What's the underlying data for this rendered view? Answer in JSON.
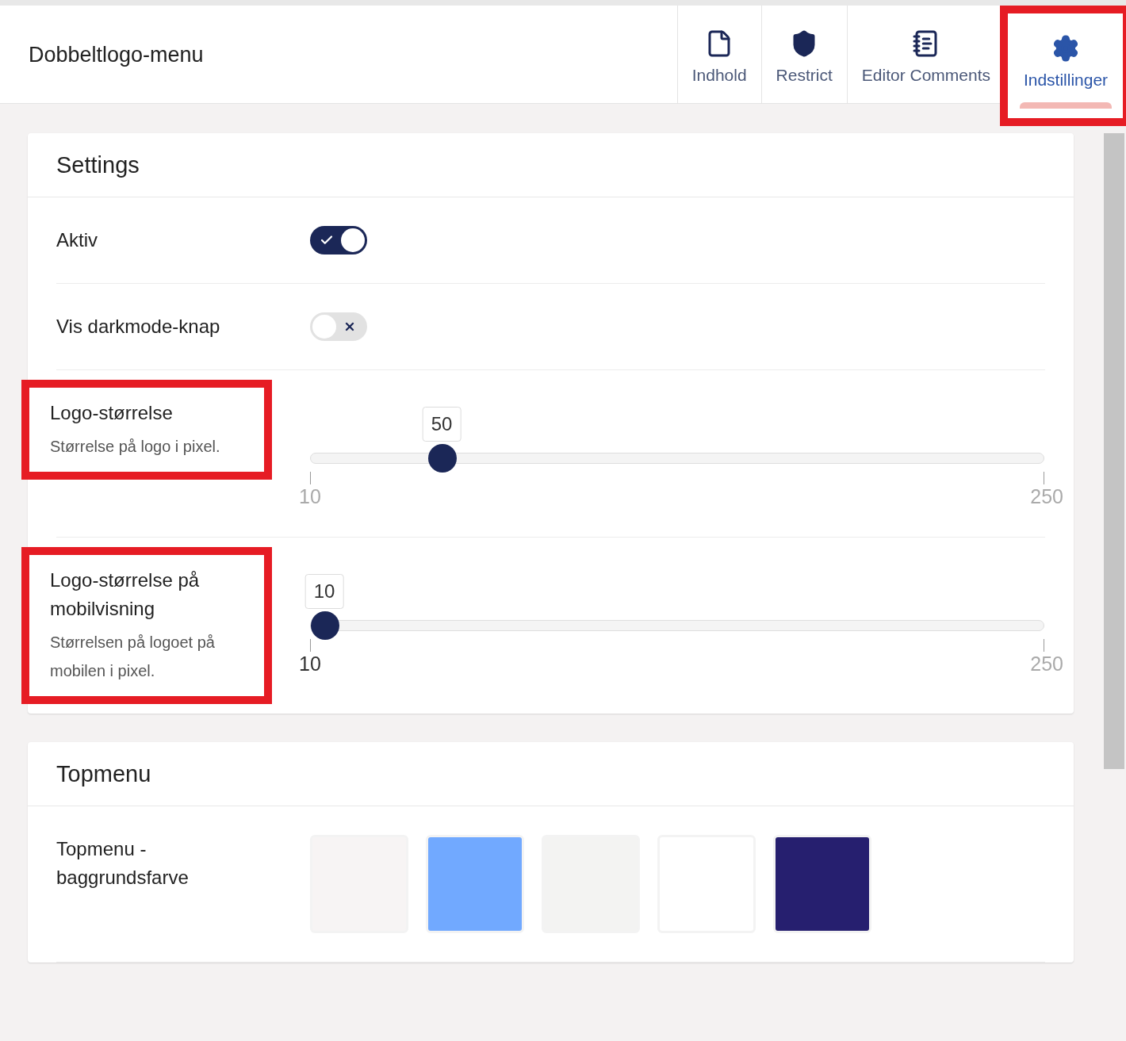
{
  "header": {
    "title": "Dobbeltlogo-menu"
  },
  "tabs": [
    {
      "label": "Indhold",
      "selected": false,
      "highlighted": false
    },
    {
      "label": "Restrict",
      "selected": false,
      "highlighted": false
    },
    {
      "label": "Editor Comments",
      "selected": false,
      "highlighted": false
    },
    {
      "label": "Indstillinger",
      "selected": true,
      "highlighted": true
    }
  ],
  "sections": [
    {
      "title": "Settings",
      "rows": [
        {
          "kind": "toggle",
          "label": "Aktiv",
          "on": true,
          "highlighted": false
        },
        {
          "kind": "toggle",
          "label": "Vis darkmode-knap",
          "on": false,
          "highlighted": false
        },
        {
          "kind": "slider",
          "label": "Logo-størrelse",
          "description": "Størrelse på logo i pixel.",
          "value": "50",
          "level": 0.1667,
          "min": "10",
          "max": "250",
          "highlighted": true
        },
        {
          "kind": "slider",
          "label": "Logo-størrelse på mobilvisning",
          "description": "Størrelsen på logoet på mobilen i pixel.",
          "value": "10",
          "level": 0,
          "min": "10",
          "max": "250",
          "highlighted": true
        }
      ]
    },
    {
      "title": "Topmenu",
      "rows": [
        {
          "kind": "colors",
          "label": "Topmenu - baggrundsfarve",
          "highlighted": false,
          "swatches": [
            {
              "color": "#f7f4f4"
            },
            {
              "color": "#71a9ff"
            },
            {
              "color": "#f3f3f2"
            },
            {
              "color": "#ffffff"
            },
            {
              "color": "#261f6f"
            }
          ]
        }
      ]
    }
  ]
}
